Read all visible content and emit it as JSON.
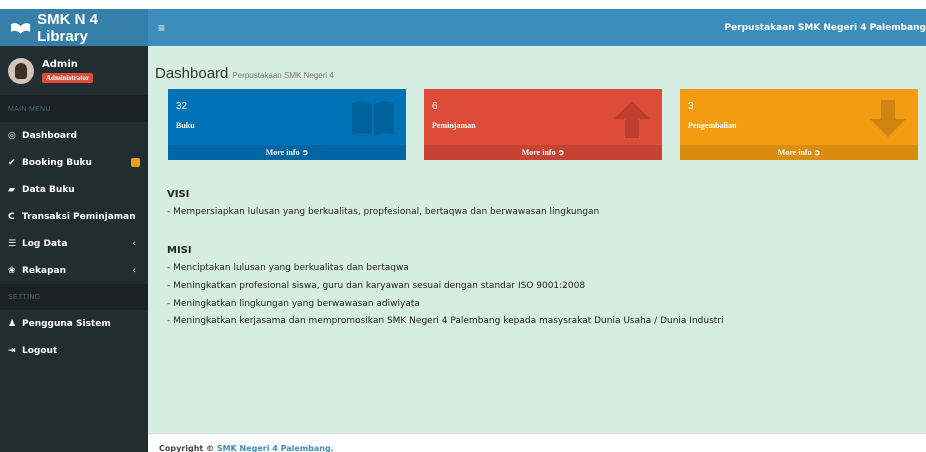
{
  "app": {
    "logo_text": "SMK N 4 Library",
    "header_title": "Perpustakaan SMK Negeri 4 Palembang",
    "toggle_icon": "menu-icon"
  },
  "user": {
    "name": "Admin",
    "role": "Administrator"
  },
  "sidebar": {
    "main_menu_header": "MAIN MENU",
    "setting_header": "SETTING",
    "items": [
      {
        "label": "Dashboard",
        "icon": "dashboard-icon"
      },
      {
        "label": "Booking Buku",
        "icon": "check-icon",
        "badge": ""
      },
      {
        "label": "Data Buku",
        "icon": "book-icon"
      },
      {
        "label": "Transaksi Peminjaman",
        "icon": "refresh-icon"
      },
      {
        "label": "Log Data",
        "icon": "list-icon"
      },
      {
        "label": "Rekapan",
        "icon": "recap-icon"
      }
    ],
    "setting_items": [
      {
        "label": "Pengguna Sistem",
        "icon": "user-icon"
      },
      {
        "label": "Logout",
        "icon": "logout-icon"
      }
    ]
  },
  "page": {
    "title": "Dashboard",
    "subtitle": "Perpustakaan SMK Negeri 4"
  },
  "boxes": [
    {
      "count": "32",
      "label": "Buku",
      "footer": "More info",
      "color": "#0073b7",
      "icon": "book-icon"
    },
    {
      "count": "6",
      "label": "Peminjaman",
      "footer": "More info",
      "color": "#dd4b39",
      "icon": "arrow-up-icon"
    },
    {
      "count": "3",
      "label": "Pengembalian",
      "footer": "More info",
      "color": "#f39c12",
      "icon": "arrow-down-icon"
    }
  ],
  "visi": {
    "heading": "VISI",
    "lines": [
      "- Mempersiapkan lulusan yang berkualitas, propfesional, bertaqwa dan berwawasan lingkungan"
    ]
  },
  "misi": {
    "heading": "MISI",
    "lines": [
      "- Menciptakan lulusan yang berkualitas dan bertaqwa",
      "- Meningkatkan profesional siswa, guru dan karyawan sesuai dengan standar ISO 9001:2008",
      "- Meningkatkan lingkungan yang berwawasan adiwiyata",
      "- Meningkatkan kerjasama dan mempromosikan SMK Negeri 4 Palembang kepada masysrakat Dunia Usaha / Dunia Industri"
    ]
  },
  "footer": {
    "prefix": "Copyright ©",
    "link": "SMK Negeri 4 Palembang."
  }
}
